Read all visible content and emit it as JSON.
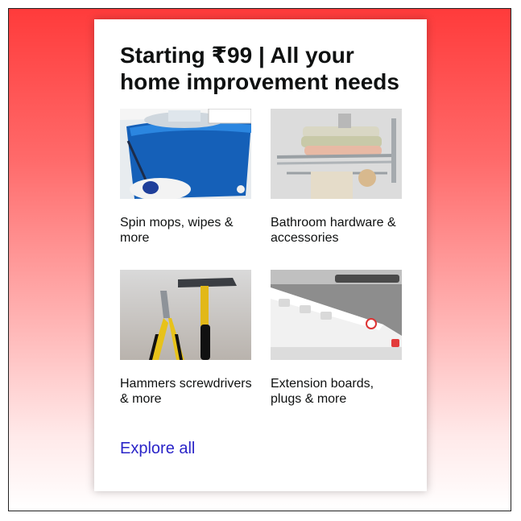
{
  "card": {
    "title": "Starting ₹99 | All your home improvement needs",
    "tiles": [
      {
        "label": "Spin mops, wipes & more",
        "image_icon": "spin-mop-bucket-image"
      },
      {
        "label": "Bathroom hardware & accessories",
        "image_icon": "towel-rack-image"
      },
      {
        "label": "Hammers screwdrivers & more",
        "image_icon": "hammer-pliers-image"
      },
      {
        "label": "Extension boards, plugs & more",
        "image_icon": "extension-board-image"
      }
    ],
    "explore_label": "Explore all"
  },
  "colors": {
    "link": "#2a24c8",
    "background_top": "#ff3b3b",
    "background_bottom": "#ffffff"
  }
}
